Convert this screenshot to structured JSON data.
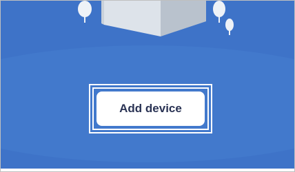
{
  "primary_action": {
    "label": "Add device"
  },
  "colors": {
    "background": "#3e73c8",
    "button_text": "#2a3354",
    "button_bg": "#ffffff"
  },
  "illustration": {
    "icons": [
      "tree-icon",
      "house-icon"
    ]
  }
}
